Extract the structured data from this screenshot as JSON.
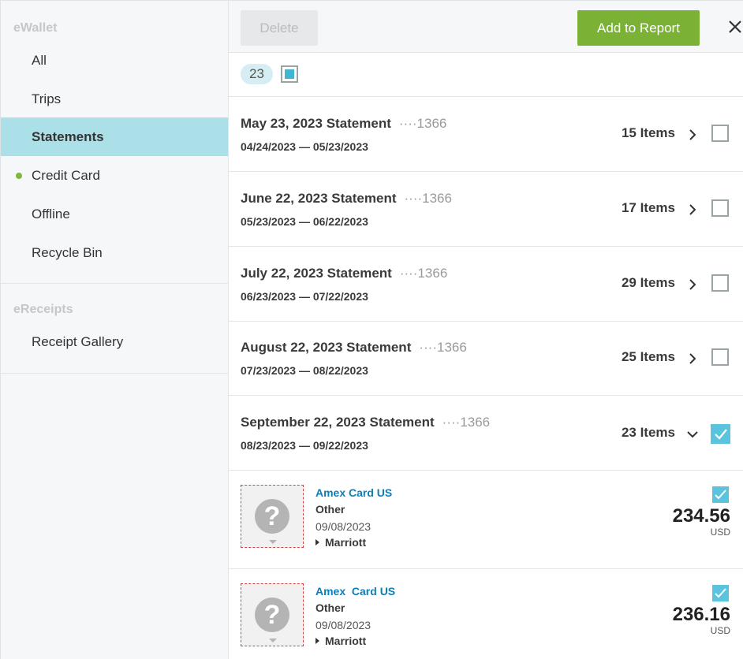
{
  "sidebar": {
    "ewallet_title": "eWallet",
    "items": [
      {
        "label": "All"
      },
      {
        "label": "Trips"
      },
      {
        "label": "Statements"
      },
      {
        "label": "Credit Card"
      },
      {
        "label": "Offline"
      },
      {
        "label": "Recycle Bin"
      }
    ],
    "ereceipts_title": "eReceipts",
    "ereceipt_items": [
      {
        "label": "Receipt Gallery"
      }
    ]
  },
  "toolbar": {
    "delete_label": "Delete",
    "add_label": "Add to Report"
  },
  "selection": {
    "count": "23"
  },
  "statements": [
    {
      "title": "May 23, 2023 Statement",
      "card": "····1366",
      "dates": "04/24/2023 — 05/23/2023",
      "items": "15 Items",
      "expanded": false,
      "checked": false
    },
    {
      "title": "June 22, 2023 Statement",
      "card": "····1366",
      "dates": "05/23/2023 — 06/22/2023",
      "items": "17 Items",
      "expanded": false,
      "checked": false
    },
    {
      "title": "July 22, 2023 Statement",
      "card": "····1366",
      "dates": "06/23/2023 — 07/22/2023",
      "items": "29 Items",
      "expanded": false,
      "checked": false
    },
    {
      "title": "August 22, 2023 Statement",
      "card": "····1366",
      "dates": "07/23/2023 — 08/22/2023",
      "items": "25 Items",
      "expanded": false,
      "checked": false
    },
    {
      "title": "September 22, 2023 Statement",
      "card": "····1366",
      "dates": "08/23/2023 — 09/22/2023",
      "items": "23 Items",
      "expanded": true,
      "checked": true
    }
  ],
  "transactions": [
    {
      "card": "Amex Card US",
      "type": "Other",
      "date": "09/08/2023",
      "vendor": "Marriott",
      "amount": "234.56",
      "currency": "USD",
      "checked": true
    },
    {
      "card": "Amex  Card US",
      "type": "Other",
      "date": "09/08/2023",
      "vendor": "Marriott",
      "amount": "236.16",
      "currency": "USD",
      "checked": true
    }
  ],
  "colors": {
    "accent_green": "#7bb235",
    "active_nav": "#abe0e9",
    "check_blue": "#5ac3dd",
    "link_blue": "#0a7fb8",
    "dot_green": "#7db83a"
  }
}
